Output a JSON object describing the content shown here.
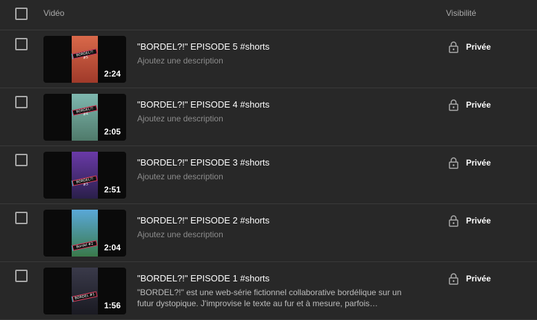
{
  "header": {
    "video_label": "Vidéo",
    "visibility_label": "Visibilité"
  },
  "videos": [
    {
      "title": "\"BORDEL?!\" EPISODE 5 #shorts",
      "description": "Ajoutez une description",
      "duration": "2:24",
      "visibility": "Privée",
      "thumb_tag": "BORDEL?! #5",
      "thumb_colors": [
        "#d9694a",
        "#a03a2a"
      ]
    },
    {
      "title": "\"BORDEL?!\" EPISODE 4 #shorts",
      "description": "Ajoutez une description",
      "duration": "2:05",
      "visibility": "Privée",
      "thumb_tag": "BORDEL?! #4",
      "thumb_colors": [
        "#7fb8b0",
        "#4f7a6a"
      ]
    },
    {
      "title": "\"BORDEL?!\" EPISODE 3 #shorts",
      "description": "Ajoutez une description",
      "duration": "2:51",
      "visibility": "Privée",
      "thumb_tag": "BORDEL?! #3",
      "thumb_colors": [
        "#6a3aa8",
        "#2a1f4a"
      ]
    },
    {
      "title": "\"BORDEL?!\" EPISODE 2 #shorts",
      "description": "Ajoutez une description",
      "duration": "2:04",
      "visibility": "Privée",
      "thumb_tag": "Bordel #2",
      "thumb_colors": [
        "#5aa8d8",
        "#3a7a4a"
      ]
    },
    {
      "title": "\"BORDEL?!\" EPISODE 1 #shorts",
      "description": "\"BORDEL?!\" est une web-série fictionnel collaborative bordélique sur un futur dystopique. J'improvise le texte au fur et à mesure, parfois…",
      "duration": "1:56",
      "visibility": "Privée",
      "thumb_tag": "BORDEL #1",
      "thumb_colors": [
        "#3a3a4a",
        "#1a1a22"
      ]
    }
  ]
}
